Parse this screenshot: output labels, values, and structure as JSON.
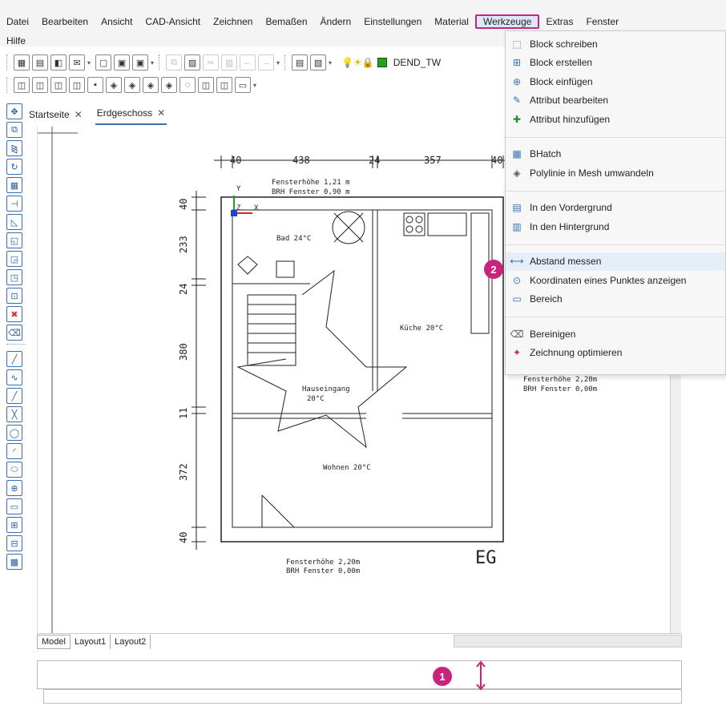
{
  "menu": {
    "row1": [
      "Datei",
      "Bearbeiten",
      "Ansicht",
      "CAD-Ansicht",
      "Zeichnen",
      "Bemaßen",
      "Ändern",
      "Einstellungen",
      "Material",
      "Werkzeuge",
      "Extras",
      "Fenster"
    ],
    "row2": [
      "Hilfe"
    ],
    "active": "Werkzeuge"
  },
  "toolbar": {
    "layer_name": "DEND_TW",
    "layer_color": "#22a022"
  },
  "tabs": [
    {
      "label": "Startseite",
      "close": "✕"
    },
    {
      "label": "Erdgeschoss",
      "close": "✕"
    }
  ],
  "dropdown": {
    "items": [
      {
        "label": "Block schreiben",
        "icon": "block-write-icon"
      },
      {
        "label": "Block erstellen",
        "icon": "block-create-icon"
      },
      {
        "label": "Block einfügen",
        "icon": "block-insert-icon"
      },
      {
        "label": "Attribut bearbeiten",
        "icon": "attribute-edit-icon"
      },
      {
        "label": "Attribut hinzufügen",
        "icon": "attribute-add-icon"
      },
      {
        "label": "BHatch",
        "icon": "hatch-icon"
      },
      {
        "label": "Polylinie in Mesh umwandeln",
        "icon": "mesh-icon"
      },
      {
        "label": "In den Vordergrund",
        "icon": "foreground-icon"
      },
      {
        "label": "In den Hintergrund",
        "icon": "background-icon"
      },
      {
        "label": "Abstand messen",
        "icon": "measure-distance-icon"
      },
      {
        "label": "Koordinaten eines Punktes anzeigen",
        "icon": "coordinates-icon"
      },
      {
        "label": "Bereich",
        "icon": "area-icon"
      },
      {
        "label": "Bereinigen",
        "icon": "purge-icon"
      },
      {
        "label": "Zeichnung optimieren",
        "icon": "optimize-icon"
      }
    ]
  },
  "badges": {
    "one": "1",
    "two": "2"
  },
  "layout_tabs": [
    "Model",
    "Layout1",
    "Layout2"
  ],
  "drawing": {
    "dims_top": [
      "40",
      "438",
      "24",
      "357",
      "40"
    ],
    "dims_left": [
      "40",
      "233",
      "24",
      "380",
      "11",
      "372",
      "40"
    ],
    "window_note_top_1": "Fensterhöhe 1,21 m",
    "window_note_top_2": "BRH Fenster 0,90 m",
    "room_bad": "Bad 24°C",
    "room_kueche": "Küche 20°C",
    "room_haus_1": "Hauseingang",
    "room_haus_2": "20°C",
    "room_wohnen": "Wohnen 20°C",
    "window_note_bottom_1": "Fensterhöhe 2,20m",
    "window_note_bottom_2": "BRH Fenster 0,00m",
    "window_note_right_1": "Fensterhöhe 2,20m",
    "window_note_right_2": "BRH Fenster 0,00m",
    "floor_label": "EG",
    "axis_y": "Y",
    "axis_z": "Z",
    "axis_x": "X"
  }
}
